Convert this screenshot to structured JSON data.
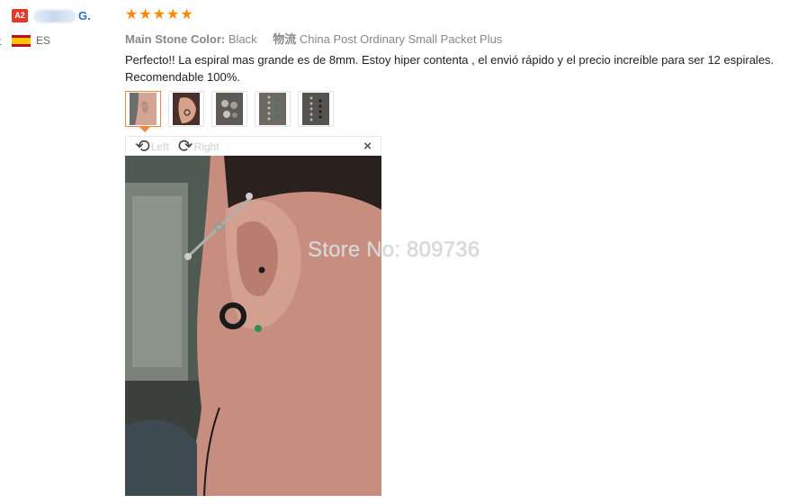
{
  "reviewer": {
    "level_badge": "A2",
    "name": "G.",
    "country": "ES",
    "flag_colors": [
      "#c60b1e",
      "#ffc400"
    ]
  },
  "left_edge_text": "t",
  "rating": {
    "stars": 5,
    "max": 5,
    "color": "#f98a07"
  },
  "attributes": {
    "main_stone_color_label": "Main Stone Color:",
    "main_stone_color_value": "Black",
    "shipping_label": "物流",
    "shipping_value": "China Post Ordinary Small Packet Plus"
  },
  "review_text": "Perfecto!! La espiral mas grande es de 8mm. Estoy hiper contenta , el envió rápido y el precio increíble para ser 12 espirales. Recomendable 100%.",
  "thumbnails": [
    {
      "icon": "ear-photo-thumbnail",
      "active": true
    },
    {
      "icon": "ear-photo-thumbnail",
      "active": false
    },
    {
      "icon": "jewelry-pack-thumbnail",
      "active": false
    },
    {
      "icon": "jewelry-pack-thumbnail",
      "active": false
    },
    {
      "icon": "jewelry-pack-thumbnail",
      "active": false
    }
  ],
  "viewer": {
    "rotate_left_label": "Left",
    "rotate_right_label": "Right",
    "close_label": "×"
  },
  "watermark": "Store No: 809736",
  "colors": {
    "accent": "#f3883a",
    "link": "#2a70c7",
    "badge": "#e13a2b"
  }
}
